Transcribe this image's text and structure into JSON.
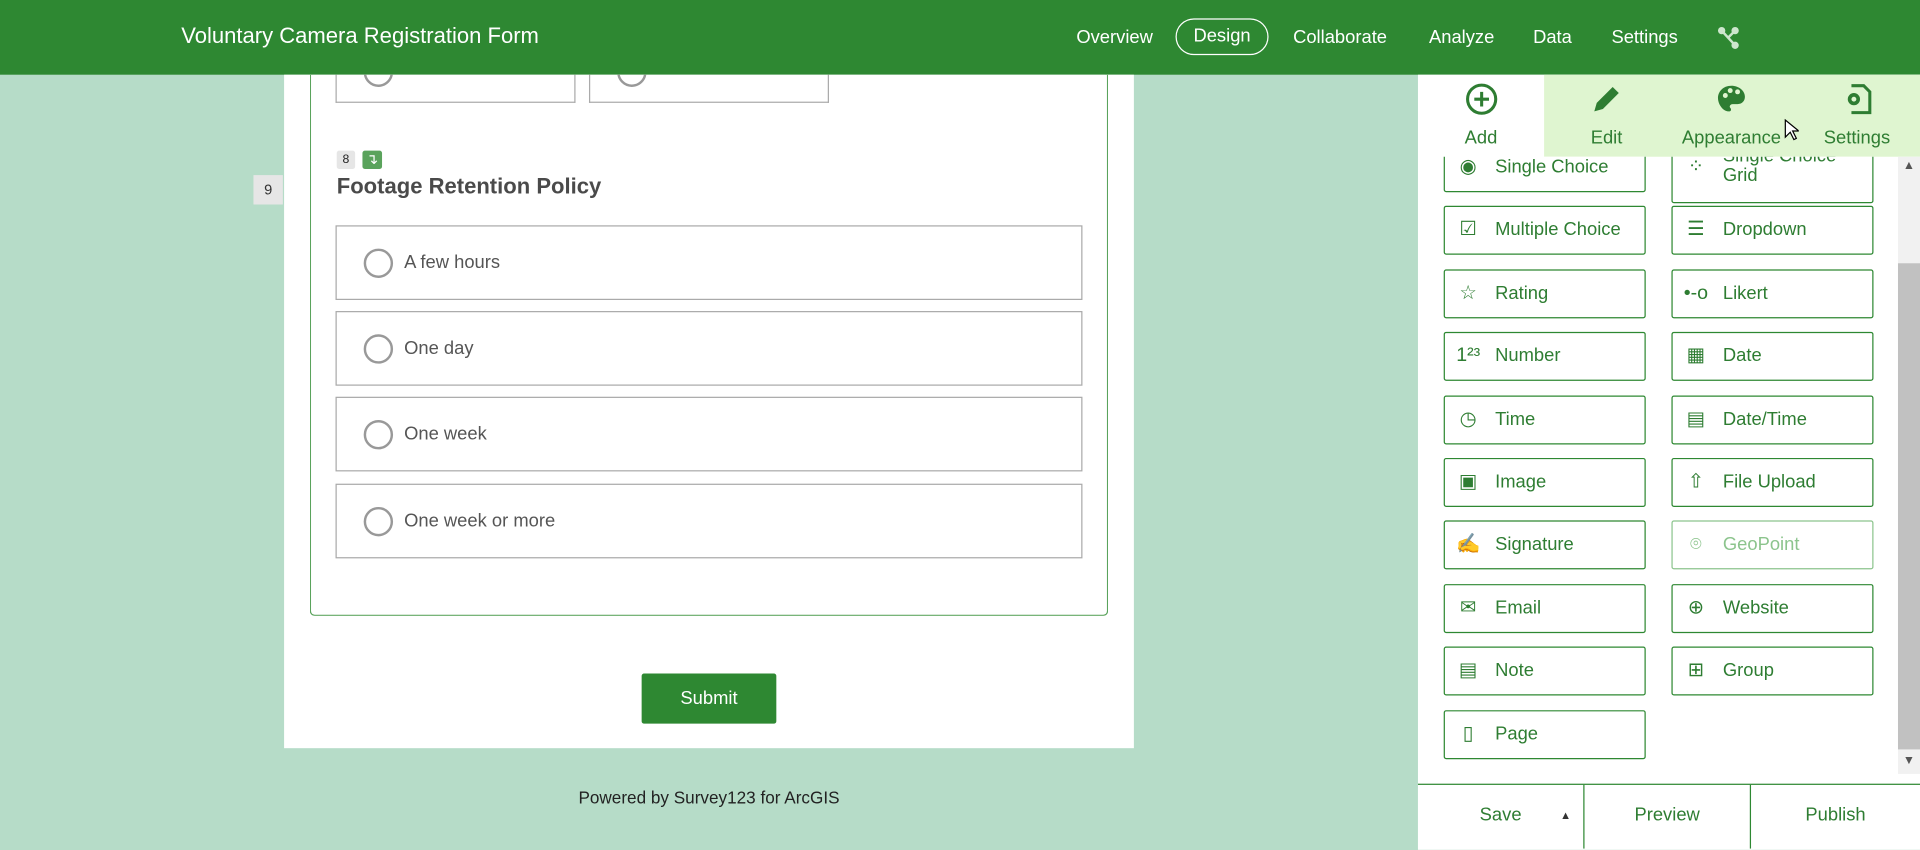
{
  "header": {
    "title": "Voluntary Camera Registration Form",
    "nav": [
      "Overview",
      "Design",
      "Collaborate",
      "Analyze",
      "Data",
      "Settings"
    ],
    "active": "Design"
  },
  "form": {
    "prev_badge": "8",
    "question_number": "9",
    "question_title": "Footage Retention Policy",
    "options": [
      "A few hours",
      "One day",
      "One week",
      "One week or more"
    ],
    "submit": "Submit",
    "powered_by": "Powered by Survey123 for ArcGIS"
  },
  "panel": {
    "tabs": [
      {
        "label": "Add",
        "icon": "add-circle-icon"
      },
      {
        "label": "Edit",
        "icon": "pencil-icon"
      },
      {
        "label": "Appearance",
        "icon": "palette-icon"
      },
      {
        "label": "Settings",
        "icon": "settings-file-icon"
      }
    ],
    "tools": [
      {
        "label": "Single Choice",
        "icon": "◉"
      },
      {
        "label": "Single Choice Grid",
        "icon": "⁘"
      },
      {
        "label": "Multiple Choice",
        "icon": "☑"
      },
      {
        "label": "Dropdown",
        "icon": "☰"
      },
      {
        "label": "Rating",
        "icon": "☆"
      },
      {
        "label": "Likert",
        "icon": "•-o"
      },
      {
        "label": "Number",
        "icon": "1²³"
      },
      {
        "label": "Date",
        "icon": "▦"
      },
      {
        "label": "Time",
        "icon": "◷"
      },
      {
        "label": "Date/Time",
        "icon": "▤"
      },
      {
        "label": "Image",
        "icon": "▣"
      },
      {
        "label": "File Upload",
        "icon": "⇧"
      },
      {
        "label": "Signature",
        "icon": "✍"
      },
      {
        "label": "GeoPoint",
        "icon": "⌾"
      },
      {
        "label": "Email",
        "icon": "✉"
      },
      {
        "label": "Website",
        "icon": "⊕"
      },
      {
        "label": "Note",
        "icon": "▤"
      },
      {
        "label": "Group",
        "icon": "⊞"
      },
      {
        "label": "Page",
        "icon": "▯"
      }
    ],
    "footer": {
      "save": "Save",
      "preview": "Preview",
      "publish": "Publish"
    }
  },
  "colors": {
    "brand": "#2e8832",
    "background": "#b6dcc8",
    "tab_highlight": "#dff5d0"
  }
}
